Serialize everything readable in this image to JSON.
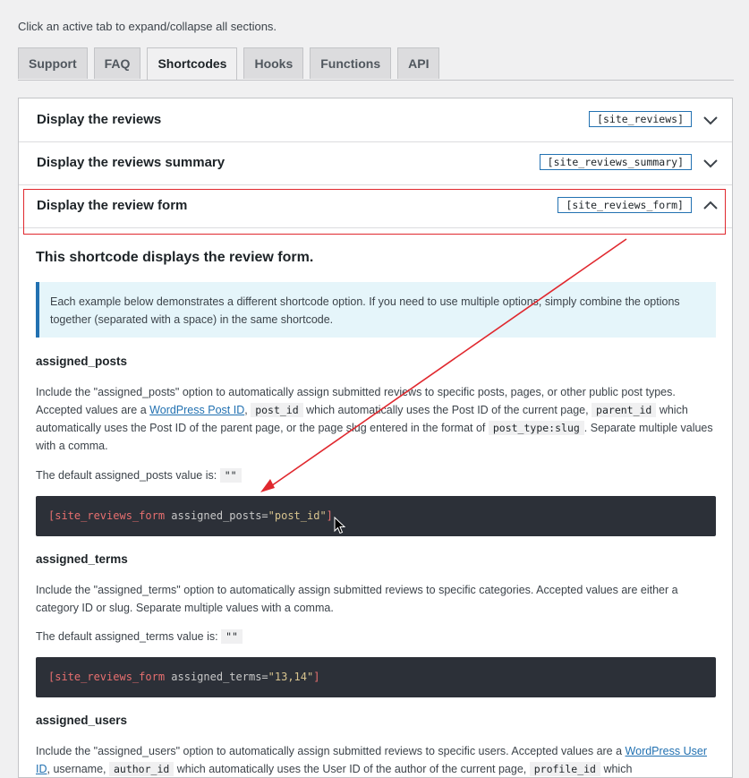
{
  "hint": "Click an active tab to expand/collapse all sections.",
  "tabs": [
    "Support",
    "FAQ",
    "Shortcodes",
    "Hooks",
    "Functions",
    "API"
  ],
  "active_tab": "Shortcodes",
  "sections": [
    {
      "title": "Display the reviews",
      "shortcode": "[site_reviews]"
    },
    {
      "title": "Display the reviews summary",
      "shortcode": "[site_reviews_summary]"
    },
    {
      "title": "Display the review form",
      "shortcode": "[site_reviews_form]"
    }
  ],
  "content": {
    "lead": "This shortcode displays the review form.",
    "notice": "Each example below demonstrates a different shortcode option. If you need to use multiple options, simply combine the options together (separated with a space) in the same shortcode.",
    "assigned_posts": {
      "heading": "assigned_posts",
      "p1_a": "Include the \"assigned_posts\" option to automatically assign submitted reviews to specific posts, pages, or other public post types. Accepted values are a ",
      "link": "WordPress Post ID",
      "p1_b": ", ",
      "code1": "post_id",
      "p1_c": " which automatically uses the Post ID of the current page, ",
      "code2": "parent_id",
      "p1_d": " which automatically uses the Post ID of the parent page, or the page slug entered in the format of ",
      "code3": "post_type:slug",
      "p1_e": ". Separate multiple values with a comma.",
      "default_label": "The default assigned_posts value is: ",
      "default_value": "\"\"",
      "example_tag": "[site_reviews_form",
      "example_attr": " assigned_posts=",
      "example_val": "\"post_id\"",
      "example_end": "]"
    },
    "assigned_terms": {
      "heading": "assigned_terms",
      "p1": "Include the \"assigned_terms\" option to automatically assign submitted reviews to specific categories. Accepted values are either a category ID or slug. Separate multiple values with a comma.",
      "default_label": "The default assigned_terms value is: ",
      "default_value": "\"\"",
      "example_tag": "[site_reviews_form",
      "example_attr": " assigned_terms=",
      "example_val": "\"13,14\"",
      "example_end": "]"
    },
    "assigned_users": {
      "heading": "assigned_users",
      "p1_a": "Include the \"assigned_users\" option to automatically assign submitted reviews to specific users. Accepted values are a ",
      "link": "WordPress User ID",
      "p1_b": ", username, ",
      "code1": "author_id",
      "p1_c": " which automatically uses the User ID of the author of the current page, ",
      "code2": "profile_id",
      "p1_d": " which"
    }
  },
  "colors": {
    "accent": "#2271b1",
    "highlight": "#e0282e",
    "code_bg": "#2c3038"
  }
}
